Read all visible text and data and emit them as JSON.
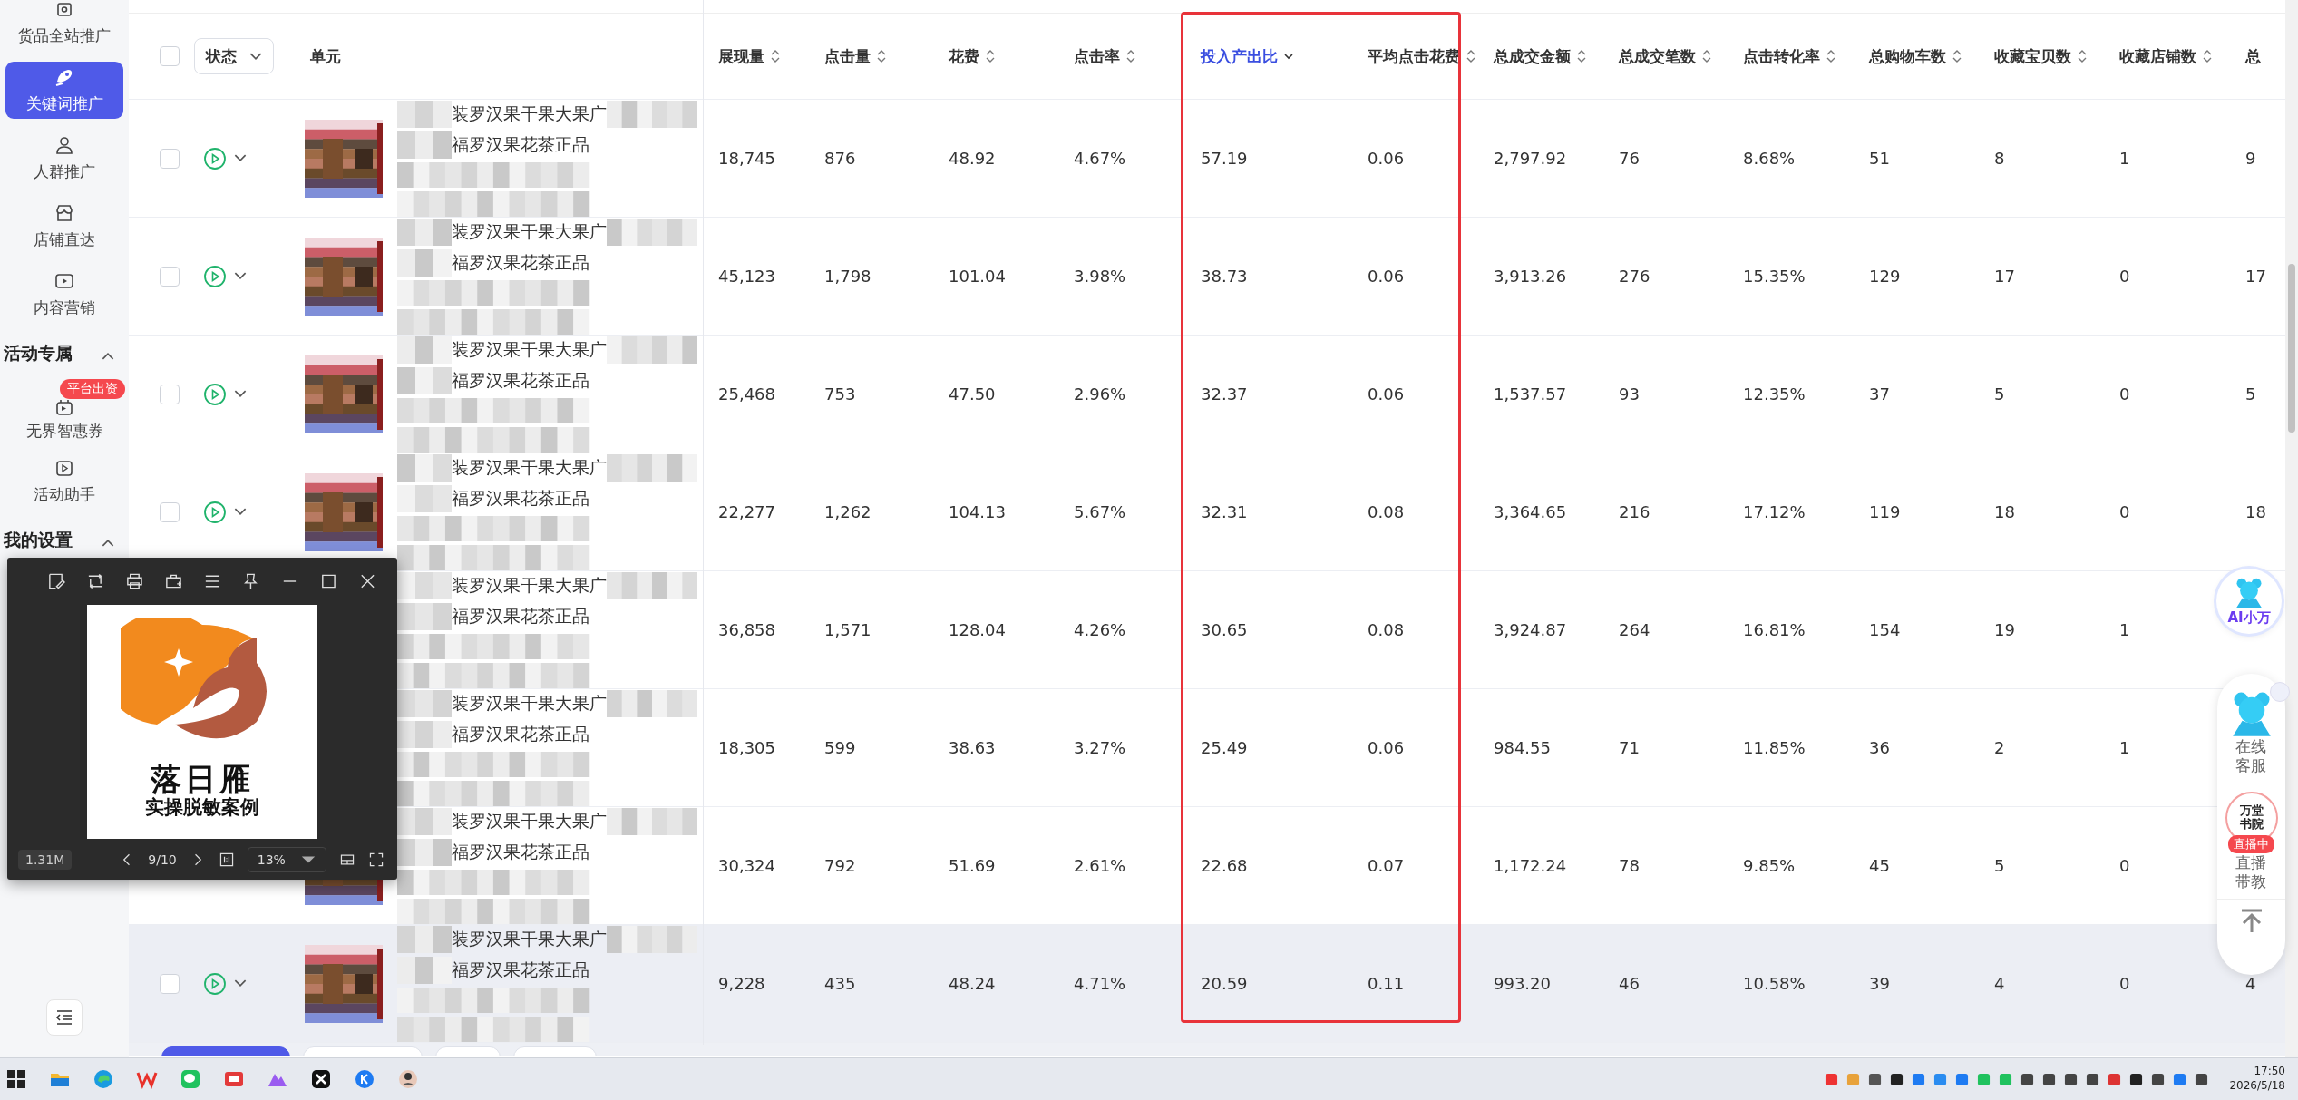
{
  "sidebar": {
    "items": [
      {
        "kind": "item",
        "label": "货品全站推广",
        "selected": false
      },
      {
        "kind": "item",
        "label": "关键词推广",
        "selected": true
      },
      {
        "kind": "item",
        "label": "人群推广",
        "selected": false
      },
      {
        "kind": "item",
        "label": "店铺直达",
        "selected": false
      },
      {
        "kind": "item",
        "label": "内容营销",
        "selected": false
      },
      {
        "kind": "section",
        "label": "活动专属",
        "expanded": true
      },
      {
        "kind": "item",
        "label": "无界智惠券",
        "selected": false,
        "badge": "平台出资"
      },
      {
        "kind": "item",
        "label": "活动助手",
        "selected": false
      },
      {
        "kind": "section",
        "label": "我的设置",
        "expanded": true
      }
    ]
  },
  "table": {
    "select_all_checked": false,
    "status_filter": "状态",
    "unit_header": "单元",
    "columns": [
      {
        "kind": "sort",
        "label": "展现量",
        "sorted": false,
        "highlighted": false
      },
      {
        "kind": "sort",
        "label": "点击量",
        "sorted": false,
        "highlighted": false
      },
      {
        "kind": "sort",
        "label": "花费",
        "sorted": false,
        "highlighted": false
      },
      {
        "kind": "sort",
        "label": "点击率",
        "sorted": false,
        "highlighted": false
      },
      {
        "kind": "sort",
        "label": "投入产出比",
        "sorted": true,
        "highlighted": true
      },
      {
        "kind": "sort",
        "label": "平均点击花费",
        "sorted": false,
        "highlighted": true
      },
      {
        "kind": "sort",
        "label": "总成交金额",
        "sorted": false,
        "highlighted": false
      },
      {
        "kind": "sort",
        "label": "总成交笔数",
        "sorted": false,
        "highlighted": false
      },
      {
        "kind": "sort",
        "label": "点击转化率",
        "sorted": false,
        "highlighted": false
      },
      {
        "kind": "sort",
        "label": "总购物车数",
        "sorted": false,
        "highlighted": false
      },
      {
        "kind": "sort",
        "label": "收藏宝贝数",
        "sorted": false,
        "highlighted": false
      },
      {
        "kind": "sort",
        "label": "收藏店铺数",
        "sorted": false,
        "highlighted": false
      },
      {
        "kind": "plain",
        "label": "总"
      }
    ],
    "rows": [
      {
        "checked": false,
        "hovered": false,
        "product_lines": [
          "装罗汉果干果大果广",
          "福罗汉果花茶正品"
        ],
        "cells": [
          "18,745",
          "876",
          "48.92",
          "4.67%",
          "57.19",
          "0.06",
          "2,797.92",
          "76",
          "8.68%",
          "51",
          "8",
          "1",
          "9"
        ]
      },
      {
        "checked": false,
        "hovered": false,
        "product_lines": [
          "装罗汉果干果大果广",
          "福罗汉果花茶正品"
        ],
        "cells": [
          "45,123",
          "1,798",
          "101.04",
          "3.98%",
          "38.73",
          "0.06",
          "3,913.26",
          "276",
          "15.35%",
          "129",
          "17",
          "0",
          "17"
        ]
      },
      {
        "checked": false,
        "hovered": false,
        "product_lines": [
          "装罗汉果干果大果广",
          "福罗汉果花茶正品"
        ],
        "cells": [
          "25,468",
          "753",
          "47.50",
          "2.96%",
          "32.37",
          "0.06",
          "1,537.57",
          "93",
          "12.35%",
          "37",
          "5",
          "0",
          "5"
        ]
      },
      {
        "checked": false,
        "hovered": false,
        "product_lines": [
          "装罗汉果干果大果广",
          "福罗汉果花茶正品"
        ],
        "cells": [
          "22,277",
          "1,262",
          "104.13",
          "5.67%",
          "32.31",
          "0.08",
          "3,364.65",
          "216",
          "17.12%",
          "119",
          "18",
          "0",
          "18"
        ]
      },
      {
        "hovered": false,
        "product_lines": [
          "装罗汉果干果大果广",
          "福罗汉果花茶正品"
        ],
        "cells": [
          "36,858",
          "1,571",
          "128.04",
          "4.26%",
          "30.65",
          "0.08",
          "3,924.87",
          "264",
          "16.81%",
          "154",
          "19",
          "1"
        ]
      },
      {
        "hovered": false,
        "product_lines": [
          "装罗汉果干果大果广",
          "福罗汉果花茶正品"
        ],
        "cells": [
          "18,305",
          "599",
          "38.63",
          "3.27%",
          "25.49",
          "0.06",
          "984.55",
          "71",
          "11.85%",
          "36",
          "2",
          "1"
        ]
      },
      {
        "hovered": false,
        "product_lines": [
          "装罗汉果干果大果广",
          "福罗汉果花茶正品"
        ],
        "cells": [
          "30,324",
          "792",
          "51.69",
          "2.61%",
          "22.68",
          "0.07",
          "1,172.24",
          "78",
          "9.85%",
          "45",
          "5",
          "0"
        ]
      },
      {
        "checked": false,
        "hovered": true,
        "product_lines": [
          "装罗汉果干果大果广",
          "福罗汉果花茶正品"
        ],
        "cells": [
          "9,228",
          "435",
          "48.24",
          "4.71%",
          "20.59",
          "0.11",
          "993.20",
          "46",
          "10.58%",
          "39",
          "4",
          "0",
          "4"
        ]
      }
    ]
  },
  "assistant": {
    "ai_label": "AI小万",
    "service_label": "在线客服",
    "logo_text": "万堂书院",
    "live_badge": "直播中",
    "live_label": "直播带教"
  },
  "viewer": {
    "image_title": "落日雁",
    "image_subtitle": "实操脱敏案例",
    "file_size": "1.31M",
    "page": "9/10",
    "zoom": "13%"
  },
  "taskbar": {
    "time": "17:50",
    "date": "2026/5/18"
  }
}
